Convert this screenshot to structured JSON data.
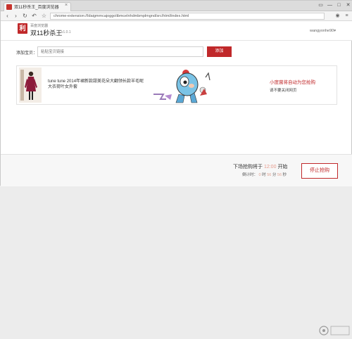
{
  "browser": {
    "tab_title": "双11秒杀王_百度浏览器",
    "tab_close": "×",
    "address": "chrome-extension://ldaigmmcajoggolibmcelnhdmbmplmgnd/src/html/index.html",
    "win_controls": [
      "▭",
      "—",
      "□",
      "✕"
    ]
  },
  "app": {
    "brand_sub": "百度浏览器",
    "brand_title": "双11秒杀王",
    "version": "v1.0.1",
    "logo_char": "利",
    "user": "wangyonhe90▾"
  },
  "add_row": {
    "label": "添加宝贝：",
    "placeholder": "粘贴宝贝链接",
    "button": "添加"
  },
  "item": {
    "title": "tune tune 2014年裙新款甜美花朵大翻领长款羊毛呢大衣荷叶女外套",
    "status_main": "小度菌将自动为您抢购",
    "status_sub": "请不要关闭网页"
  },
  "footer": {
    "next_prefix": "下场抢购将于",
    "next_time": "12:00",
    "next_suffix": "开始",
    "countdown_prefix": "倒计时：",
    "hours": "0",
    "hours_unit": "时",
    "minutes": "56",
    "minutes_unit": "分",
    "seconds": "56",
    "seconds_unit": "秒",
    "stop_button": "停止抢购"
  }
}
